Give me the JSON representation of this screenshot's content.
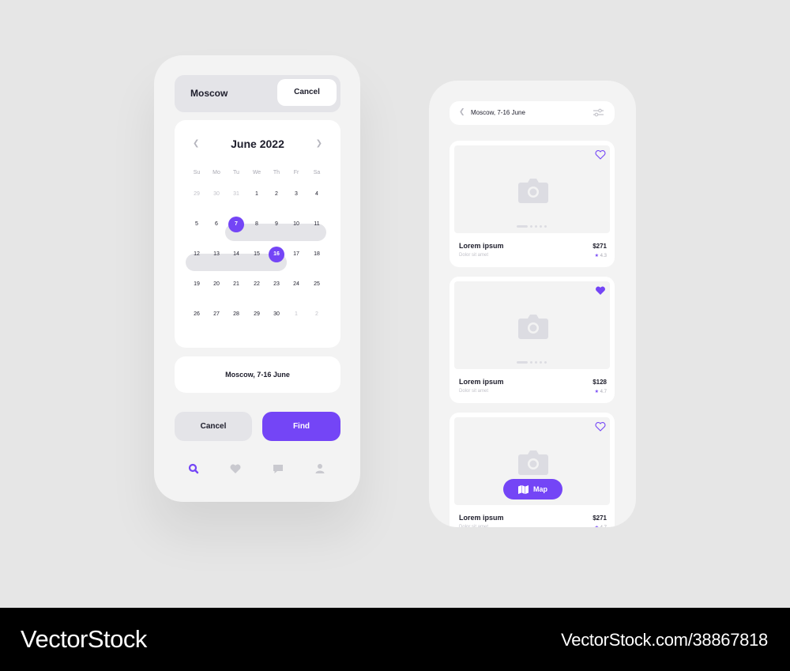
{
  "accent_color": "#7445f6",
  "search_screen": {
    "city": "Moscow",
    "cancel_label": "Cancel",
    "calendar": {
      "month_title": "June 2022",
      "prev_icon": "chevron-left-icon",
      "next_icon": "chevron-right-icon",
      "weekdays": [
        "Su",
        "Mo",
        "Tu",
        "We",
        "Th",
        "Fr",
        "Sa"
      ],
      "weeks": [
        [
          "29",
          "30",
          "31",
          "1",
          "2",
          "3",
          "4"
        ],
        [
          "5",
          "6",
          "7",
          "8",
          "9",
          "10",
          "11"
        ],
        [
          "12",
          "13",
          "14",
          "15",
          "16",
          "17",
          "18"
        ],
        [
          "19",
          "20",
          "21",
          "22",
          "23",
          "24",
          "25"
        ],
        [
          "26",
          "27",
          "28",
          "29",
          "30",
          "1",
          "2"
        ]
      ],
      "range_start": "7",
      "range_end": "16"
    },
    "summary": "Moscow, 7-16 June",
    "cancel_button": "Cancel",
    "find_button": "Find",
    "tabbar": [
      "search-icon",
      "heart-icon",
      "chat-icon",
      "profile-icon"
    ]
  },
  "results_screen": {
    "search_text": "Moscow, 7-16 June",
    "cards": [
      {
        "title": "Lorem ipsum",
        "subtitle": "Dolor sit amet",
        "price": "$271",
        "rating": "4.3",
        "favorite": false
      },
      {
        "title": "Lorem ipsum",
        "subtitle": "Dolor sit amet",
        "price": "$128",
        "rating": "4.7",
        "favorite": true
      },
      {
        "title": "Lorem ipsum",
        "subtitle": "Dolor sit amet",
        "price": "$271",
        "rating": "4.7",
        "favorite": false
      }
    ],
    "map_button": "Map"
  },
  "footer": {
    "brand": "VectorStock",
    "url": "VectorStock.com/38867818"
  }
}
